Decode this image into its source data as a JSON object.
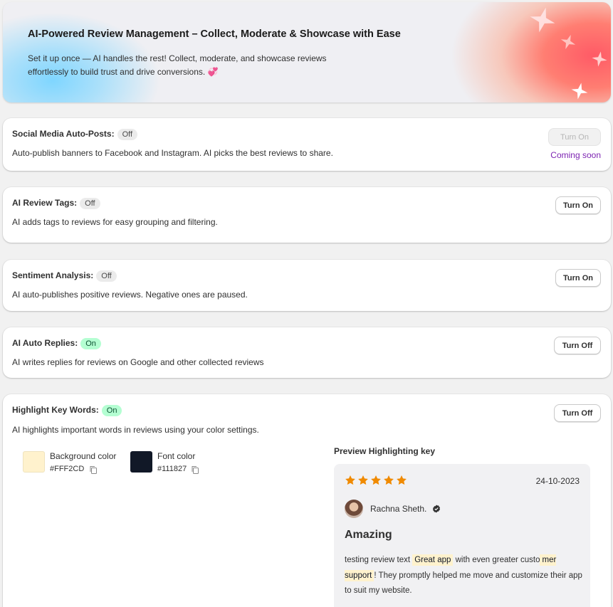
{
  "hero": {
    "title": "AI-Powered Review Management – Collect, Moderate & Showcase with Ease",
    "description": "Set it up once — AI handles the rest! Collect, moderate, and showcase reviews effortlessly to build trust and drive conversions. 💞"
  },
  "features": {
    "social": {
      "title": "Social Media Auto-Posts:",
      "status": "Off",
      "description": "Auto-publish banners to Facebook and Instagram. AI picks the best reviews to share.",
      "button": "Turn On",
      "note": "Coming soon"
    },
    "tags": {
      "title": "AI Review Tags:",
      "status": "Off",
      "description": "AI adds tags to reviews for easy grouping and filtering.",
      "button": "Turn On"
    },
    "sentiment": {
      "title": "Sentiment Analysis:",
      "status": "Off",
      "description": "AI auto-publishes positive reviews. Negative ones are paused.",
      "button": "Turn On"
    },
    "replies": {
      "title": "AI Auto Replies:",
      "status": "On",
      "description": "AI writes replies for reviews on Google and other collected reviews",
      "button": "Turn Off"
    },
    "highlight": {
      "title": "Highlight Key Words:",
      "status": "On",
      "description": "AI highlights important words in reviews using your color settings.",
      "button": "Turn Off",
      "background_color": {
        "label": "Background color",
        "hex": "#FFF2CD"
      },
      "font_color": {
        "label": "Font color",
        "hex": "#111827"
      },
      "preview_heading": "Preview Highlighting key"
    }
  },
  "preview": {
    "rating": 5,
    "date": "24-10-2023",
    "reviewer": "Rachna Sheth.",
    "title": "Amazing",
    "body": {
      "t1": "testing review text ",
      "h1": "Great app",
      "t2": " with even greater custo",
      "h2": "mer support",
      "t3": "! They promptly helped me move and customize their app to suit my website."
    }
  },
  "colors": {
    "star": "#f08a00",
    "coming_soon": "#7d24b2",
    "badge_on": "#b4fed2",
    "badge_off": "#ebebeb"
  }
}
